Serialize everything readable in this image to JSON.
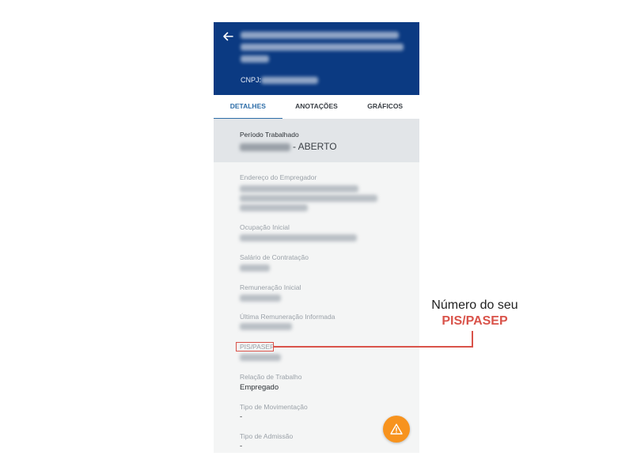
{
  "header": {
    "back_icon": "arrow-left-icon",
    "cnpj_label": "CNPJ:"
  },
  "tabs": [
    {
      "label": "DETALHES",
      "active": true
    },
    {
      "label": "ANOTAÇÕES",
      "active": false
    },
    {
      "label": "GRÁFICOS",
      "active": false
    }
  ],
  "period": {
    "label": "Período Trabalhado",
    "status": "- ABERTO"
  },
  "fields": {
    "employer_address": {
      "label": "Endereço do Empregador"
    },
    "initial_occupation": {
      "label": "Ocupação Inicial"
    },
    "hiring_salary": {
      "label": "Salário de Contratação"
    },
    "initial_remuneration": {
      "label": "Remuneração Inicial"
    },
    "last_remuneration": {
      "label": "Última Remuneração Informada"
    },
    "pis_pasep": {
      "label": "PIS/PASEP"
    },
    "work_relation": {
      "label": "Relação de Trabalho",
      "value": "Empregado"
    },
    "movement_type": {
      "label": "Tipo de Movimentação",
      "value": "-"
    },
    "admission_type": {
      "label": "Tipo de Admissão",
      "value": "-"
    }
  },
  "callout": {
    "line1": "Número do seu",
    "line2": "PIS/PASEP"
  },
  "fab": {
    "icon": "warning-icon"
  },
  "colors": {
    "header_bg": "#0b3a82",
    "accent_tab": "#2d6da8",
    "callout_red": "#d9534a",
    "fab_orange": "#f7931e"
  }
}
